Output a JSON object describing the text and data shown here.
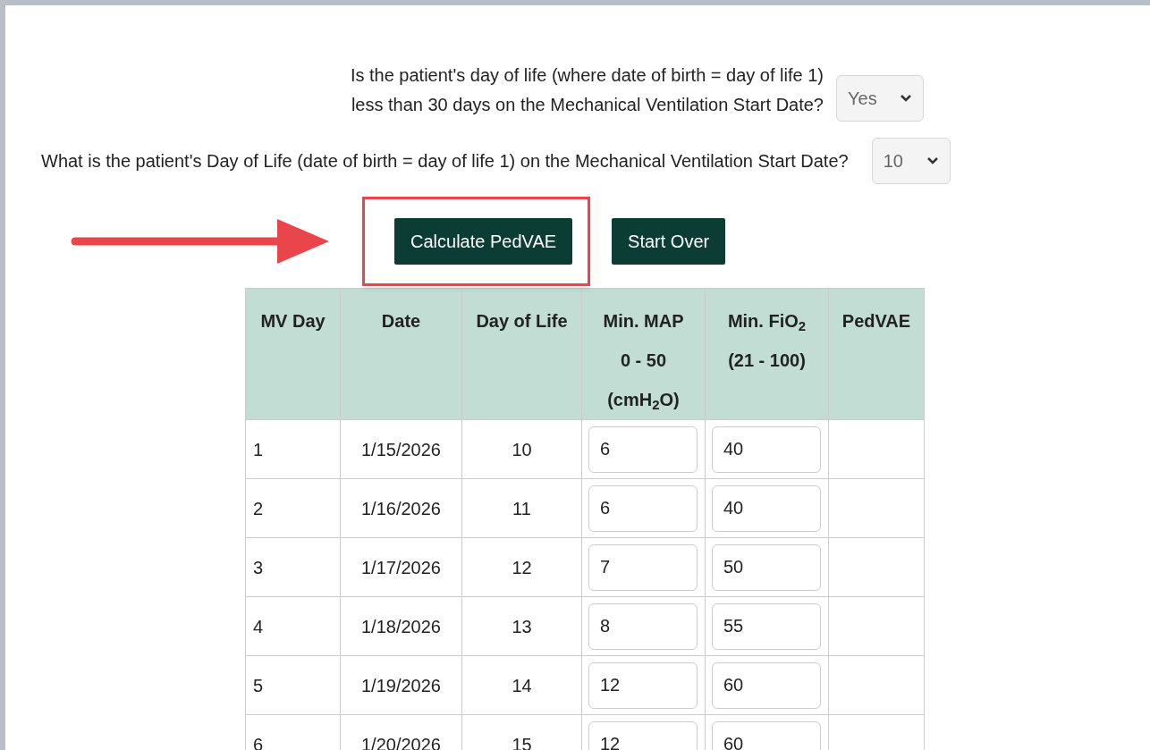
{
  "question_1": {
    "lines": [
      "Is the patient's day of life (where date of birth = day of life 1)",
      "less than 30 days on the Mechanical Ventilation Start Date?"
    ],
    "answer": "Yes"
  },
  "question_2": {
    "text": "What is the patient's Day of Life (date of birth = day of life 1) on the Mechanical Ventilation Start Date?",
    "answer": "10"
  },
  "buttons": [
    {
      "label": "Calculate PedVAE",
      "highlighted": true
    },
    {
      "label": "Start Over",
      "highlighted": false
    }
  ],
  "table": {
    "columns": [
      [
        "MV Day"
      ],
      [
        "Date"
      ],
      [
        "Day of Life"
      ],
      [
        "Min. MAP",
        "0 - 50",
        "(cmH$_{2}$O)"
      ],
      [
        "Min. FiO$_{2}$",
        "(21 - 100)"
      ],
      [
        "PedVAE"
      ]
    ],
    "rows": [
      {
        "mv_day": "1",
        "date": "1/15/2026",
        "day_of_life": "10",
        "min_map": "6",
        "min_fio2": "40"
      },
      {
        "mv_day": "2",
        "date": "1/16/2026",
        "day_of_life": "11",
        "min_map": "6",
        "min_fio2": "40"
      },
      {
        "mv_day": "3",
        "date": "1/17/2026",
        "day_of_life": "12",
        "min_map": "7",
        "min_fio2": "50"
      },
      {
        "mv_day": "4",
        "date": "1/18/2026",
        "day_of_life": "13",
        "min_map": "8",
        "min_fio2": "55"
      },
      {
        "mv_day": "5",
        "date": "1/19/2026",
        "day_of_life": "14",
        "min_map": "12",
        "min_fio2": "60"
      },
      {
        "mv_day": "6",
        "date": "1/20/2026",
        "day_of_life": "15",
        "min_map": "12",
        "min_fio2": "60"
      }
    ]
  }
}
